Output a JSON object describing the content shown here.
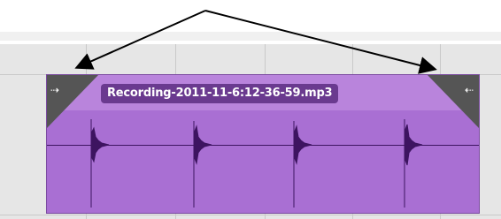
{
  "clip": {
    "filename": "Recording-2011-11-6:12-36-59.mp3",
    "color": "#a96fd3"
  },
  "handles": {
    "left_icon": "trim-start-icon",
    "right_icon": "trim-end-icon",
    "left_glyph": "⇢",
    "right_glyph": "⇠"
  },
  "annotations": {
    "arrow_color": "#000000"
  }
}
